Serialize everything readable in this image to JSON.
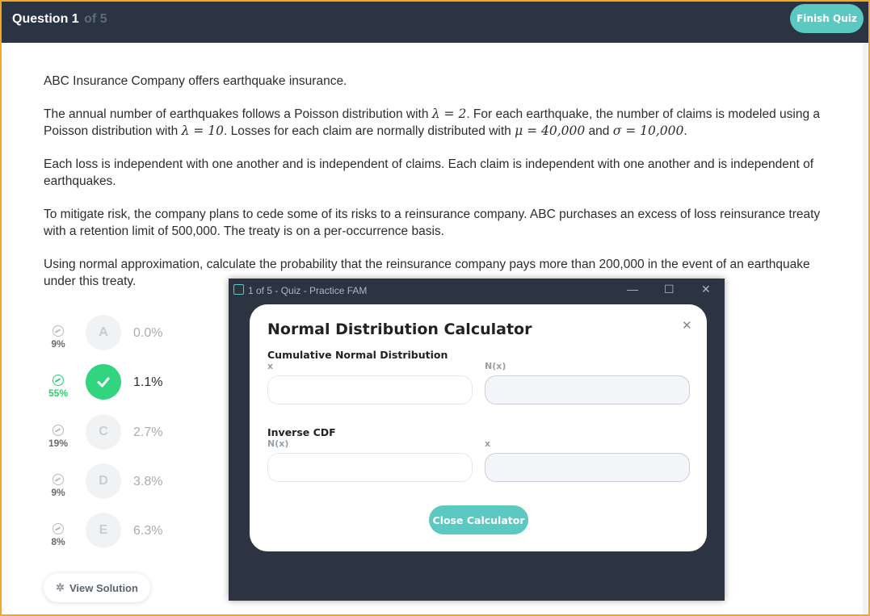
{
  "header": {
    "question_label": "Question 1",
    "question_of": "of 5",
    "finish_label": "Finish Quiz"
  },
  "question": {
    "p1": "ABC Insurance Company offers earthquake insurance.",
    "p2a": "The annual number of earthquakes follows a Poisson distribution with ",
    "p2_lambda1": "λ = 2",
    "p2b": ". For each earthquake, the number of claims is modeled using a Poisson distribution with ",
    "p2_lambda2": "λ = 10",
    "p2c": ". Losses for each claim are normally distributed with ",
    "p2_mu": "μ = 40,000",
    "p2d": " and ",
    "p2_sigma": "σ = 10,000",
    "p2e": ".",
    "p3": "Each loss is independent with one another and is independent of claims. Each claim is independent with one another and is independent of earthquakes.",
    "p4": "To mitigate risk, the company plans to cede some of its risks to a reinsurance company. ABC purchases an excess of loss reinsurance treaty with a retention limit of 500,000. The treaty is on a per-occurrence basis.",
    "p5": "Using normal approximation, calculate the probability that the reinsurance company pays more than 200,000 in the event of an earthquake under this treaty."
  },
  "answers": [
    {
      "letter": "A",
      "value": "0.0%",
      "pct": "9%",
      "correct": false
    },
    {
      "letter": "",
      "value": "1.1%",
      "pct": "55%",
      "correct": true
    },
    {
      "letter": "C",
      "value": "2.7%",
      "pct": "19%",
      "correct": false
    },
    {
      "letter": "D",
      "value": "3.8%",
      "pct": "9%",
      "correct": false
    },
    {
      "letter": "E",
      "value": "6.3%",
      "pct": "8%",
      "correct": false
    }
  ],
  "view_solution": "View Solution",
  "window": {
    "title": "1 of 5 - Quiz - Practice FAM",
    "minimize": "—",
    "maximize": "☐",
    "close": "✕"
  },
  "calculator": {
    "title": "Normal Distribution Calculator",
    "cdf_title": "Cumulative Normal Distribution",
    "cdf_x_label": "x",
    "cdf_nx_label": "N(x)",
    "cdf_x_value": "",
    "cdf_nx_value": "",
    "inv_title": "Inverse CDF",
    "inv_nx_label": "N(x)",
    "inv_x_label": "x",
    "inv_nx_value": "",
    "inv_x_value": "",
    "close_label": "Close Calculator"
  },
  "colors": {
    "accent": "#5cc8c2",
    "correct": "#33d47f",
    "header_bg": "#2b3443",
    "border": "#f5a623"
  }
}
